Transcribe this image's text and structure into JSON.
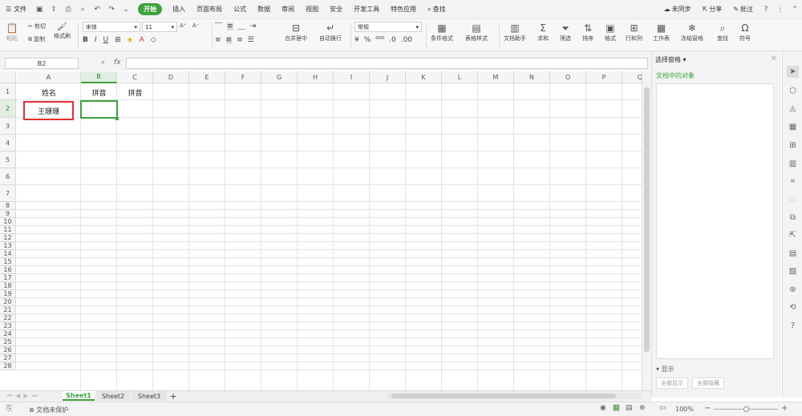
{
  "menu": {
    "file": "文件",
    "tabs": [
      "开始",
      "插入",
      "页面布局",
      "公式",
      "数据",
      "审阅",
      "视图",
      "安全",
      "开发工具",
      "特色应用"
    ],
    "active_tab": "开始",
    "search": "查找",
    "sync": "未同步",
    "share": "分享",
    "comment": "批注"
  },
  "ribbon": {
    "paste": "粘贴",
    "cut": "剪切",
    "copy": "复制",
    "format_painter": "格式刷",
    "font_name": "宋体",
    "font_size": "11",
    "merge_center": "合并居中",
    "wrap_text": "自动换行",
    "number_format": "常规",
    "cond_format": "条件格式",
    "table_style": "表格样式",
    "doc_helper": "文档助手",
    "sum": "求和",
    "filter": "筛选",
    "sort": "排序",
    "format": "格式",
    "row_col": "行和列",
    "worksheet": "工作表",
    "freeze": "冻结窗格",
    "find": "查找",
    "symbol": "符号"
  },
  "formula_bar": {
    "name_box": "B2",
    "fx": "fx",
    "value": ""
  },
  "grid": {
    "columns": [
      "A",
      "B",
      "C",
      "D",
      "E",
      "F",
      "G",
      "H",
      "I",
      "J",
      "K",
      "L",
      "M",
      "N",
      "O",
      "P",
      "Q"
    ],
    "rows": [
      "1",
      "2",
      "3",
      "4",
      "5",
      "6",
      "7",
      "8",
      "9",
      "10",
      "11",
      "12",
      "13",
      "14",
      "15",
      "16",
      "17",
      "18",
      "19",
      "20",
      "21",
      "22",
      "23",
      "24",
      "25",
      "26",
      "27",
      "28"
    ],
    "selected_cell": "B2",
    "cells": {
      "A1": "姓名",
      "B1": "拼音",
      "C1": "拼音",
      "A2": "王珊珊"
    }
  },
  "right_pane": {
    "title": "选择窗格",
    "subtitle": "文档中的对象",
    "show_all": "全部显示",
    "hide_all": "全部隐藏"
  },
  "sheets": [
    "Sheet1",
    "Sheet2",
    "Sheet3"
  ],
  "active_sheet": "Sheet1",
  "status": {
    "protect": "文档未保护",
    "zoom": "100%"
  },
  "colors": {
    "accent": "#3ea13e",
    "highlight_border": "#e03030"
  }
}
